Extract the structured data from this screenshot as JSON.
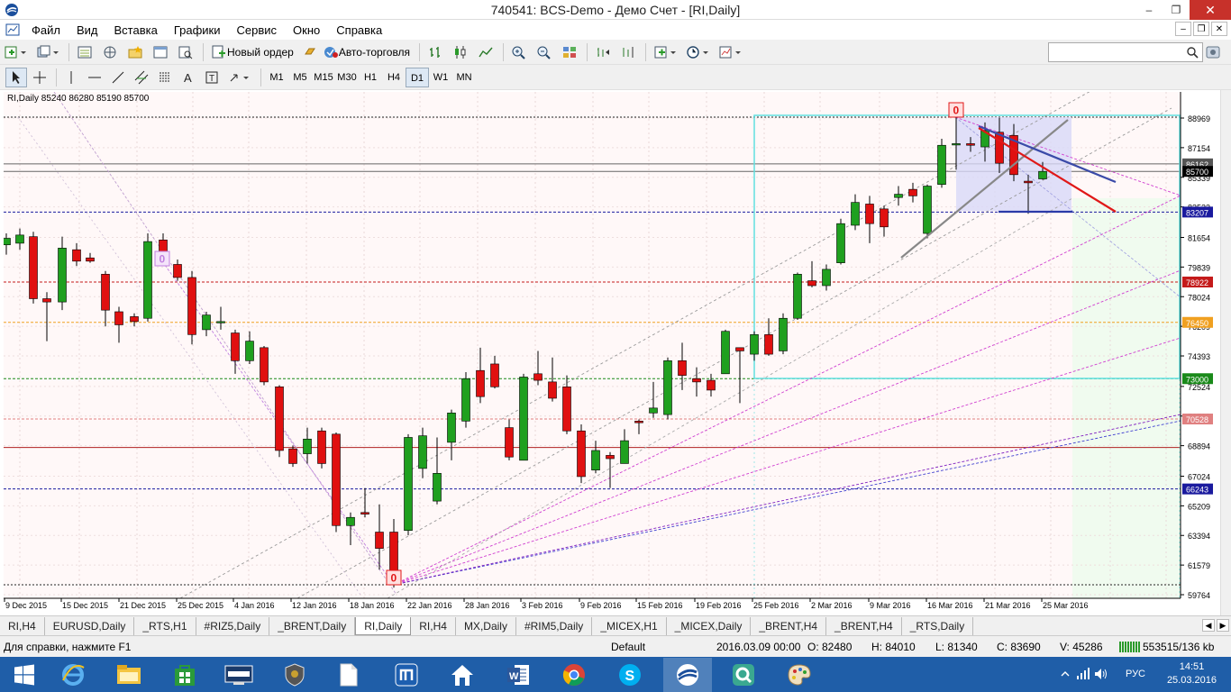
{
  "window": {
    "title": "740541: BCS-Demo - Демо Счет - [RI,Daily]",
    "controls": [
      "–",
      "❐",
      "✕"
    ]
  },
  "menu": [
    "Файл",
    "Вид",
    "Вставка",
    "Графики",
    "Сервис",
    "Окно",
    "Справка"
  ],
  "toolbar": {
    "new_order": "Новый ордер",
    "auto_trading": "Авто-торговля",
    "timeframes": [
      "M1",
      "M5",
      "M15",
      "M30",
      "H1",
      "H4",
      "D1",
      "W1",
      "MN"
    ],
    "active_timeframe": "D1"
  },
  "chart": {
    "header": "RI,Daily  85240 86280 85190 85700",
    "dates": [
      "9 Dec 2015",
      "15 Dec 2015",
      "21 Dec 2015",
      "25 Dec 2015",
      "4 Jan 2016",
      "12 Jan 2016",
      "18 Jan 2016",
      "22 Jan 2016",
      "28 Jan 2016",
      "3 Feb 2016",
      "9 Feb 2016",
      "15 Feb 2016",
      "19 Feb 2016",
      "25 Feb 2016",
      "2 Mar 2016",
      "9 Mar 2016",
      "16 Mar 2016",
      "21 Mar 2016",
      "25 Mar 2016"
    ],
    "price_ticks": [
      "88969",
      "87154",
      "85339",
      "83523",
      "81654",
      "79839",
      "78024",
      "76209",
      "74393",
      "72524",
      "70709",
      "68894",
      "67024",
      "65209",
      "63394",
      "61579",
      "59764"
    ],
    "level_labels": [
      {
        "value": "86162",
        "bg": "#555555",
        "fg": "#ffffff"
      },
      {
        "value": "85700",
        "bg": "#000000",
        "fg": "#ffffff"
      },
      {
        "value": "83207",
        "bg": "#1a1a9e",
        "fg": "#ffffff"
      },
      {
        "value": "78922",
        "bg": "#c41a1a",
        "fg": "#ffffff"
      },
      {
        "value": "76450",
        "bg": "#f0a020",
        "fg": "#ffffff"
      },
      {
        "value": "73000",
        "bg": "#1a8a1a",
        "fg": "#ffffff"
      },
      {
        "value": "70528",
        "bg": "#e08080",
        "fg": "#ffffff"
      },
      {
        "value": "66243",
        "bg": "#1a1a9e",
        "fg": "#ffffff"
      }
    ],
    "markers": [
      "0",
      "0",
      "0"
    ]
  },
  "tabs": [
    "RI,H4",
    "EURUSD,Daily",
    "_RTS,H1",
    "#RIZ5,Daily",
    "_BRENT,Daily",
    "RI,Daily",
    "RI,H4",
    "MX,Daily",
    "#RIM5,Daily",
    "_MICEX,H1",
    "_MICEX,Daily",
    "_BRENT,H4",
    "_BRENT,H4",
    "_RTS,Daily"
  ],
  "active_tab": "RI,Daily",
  "status": {
    "help": "Для справки, нажмите F1",
    "profile": "Default",
    "datetime": "2016.03.09 00:00",
    "open": "O: 82480",
    "high": "H: 84010",
    "low": "L: 81340",
    "close": "C: 83690",
    "volume": "V: 45286",
    "traffic": "553515/136 kb"
  },
  "taskbar": {
    "lang": "РУС",
    "time": "14:51",
    "date": "25.03.2016"
  },
  "colors": {
    "bull": "#1fa01f",
    "bear": "#e01010",
    "taskbar": "#1f5ea8"
  }
}
